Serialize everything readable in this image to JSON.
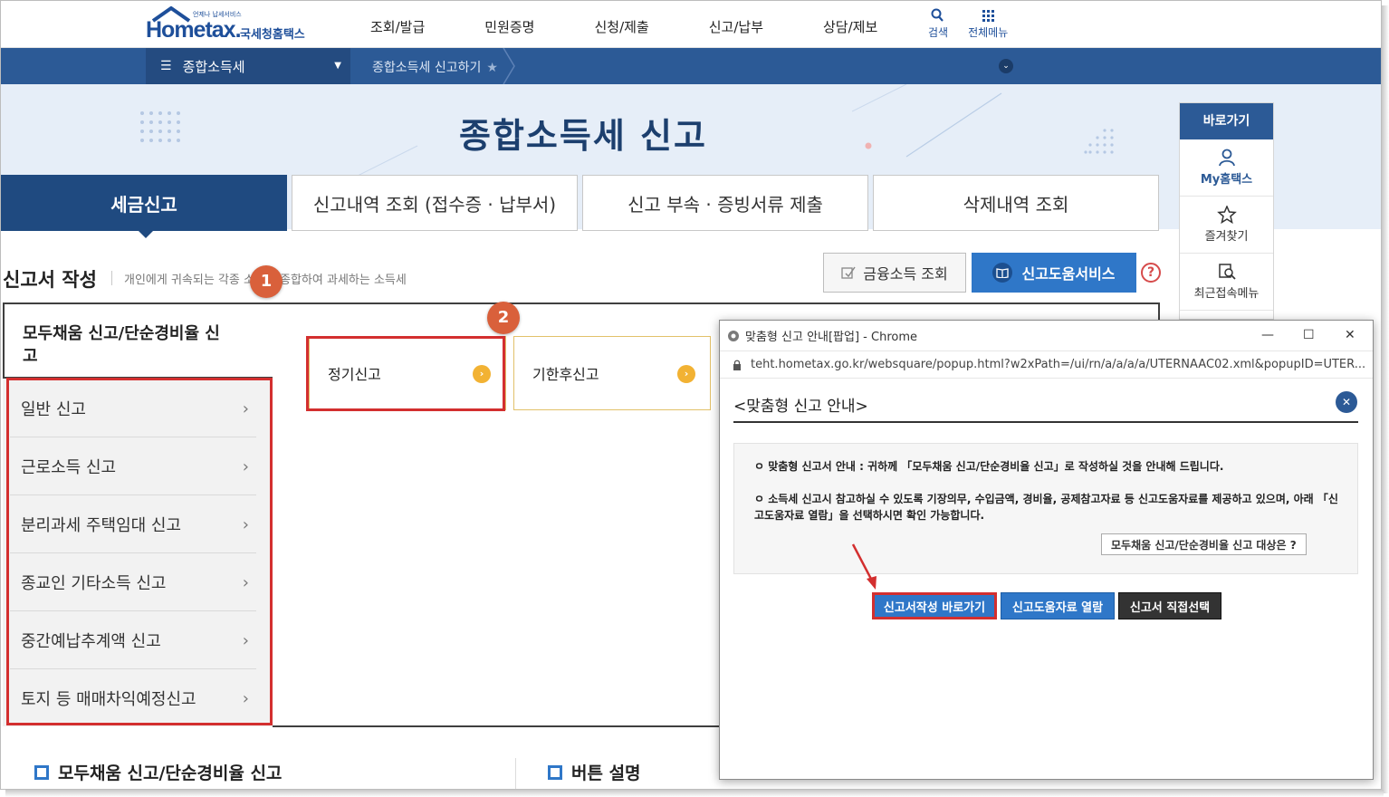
{
  "header": {
    "logo_brand": "Hometax.",
    "logo_small": "언제나 납세서비스",
    "logo_name": "국세청홈택스",
    "gnb": [
      "조회/발급",
      "민원증명",
      "신청/제출",
      "신고/납부",
      "상담/제보"
    ],
    "search_label": "검색",
    "all_menu_label": "전체메뉴"
  },
  "navbar": {
    "menu_label": "종합소득세",
    "breadcrumb": "종합소득세 신고하기"
  },
  "page": {
    "title": "종합소득세 신고"
  },
  "tabs": [
    "세금신고",
    "신고내역 조회 (접수증 · 납부서)",
    "신고 부속 · 증빙서류 제출",
    "삭제내역 조회"
  ],
  "quick": {
    "head": "바로가기",
    "items": [
      "My홈택스",
      "즐겨찾기",
      "최근접속메뉴"
    ]
  },
  "section": {
    "title": "신고서 작성",
    "desc": "개인에게 귀속되는 각종 소득을 종합하여 과세하는 소득세",
    "btn_fin": "금융소득 조회",
    "btn_help": "신고도움서비스",
    "help_q": "?"
  },
  "lnb": {
    "active": "모두채움 신고/단순경비율 신고",
    "items": [
      "일반 신고",
      "근로소득 신고",
      "분리과세 주택임대 신고",
      "종교인 기타소득 신고",
      "중간예납추계액 신고",
      "토지 등 매매차익예정신고"
    ]
  },
  "cards": [
    "정기신고",
    "기한후신고"
  ],
  "badges": [
    "1",
    "2"
  ],
  "bottom": {
    "left": "모두채움 신고/단순경비율 신고",
    "right": "버튼 설명"
  },
  "popup": {
    "window_title": "맞춤형 신고 안내[팝업] - Chrome",
    "url": "teht.hometax.go.kr/websquare/popup.html?w2xPath=/ui/rn/a/a/a/a/UTERNAAC02.xml&popupID=UTER...",
    "heading": "<맞춤형 신고 안내>",
    "line1": "ㅇ 맞춤형 신고서 안내 : 귀하께 「모두채움 신고/단순경비율 신고」로 작성하실 것을 안내해 드립니다.",
    "line2": "ㅇ 소득세 신고시 참고하실 수 있도록 기장의무, 수입금액, 경비율, 공제참고자료 등 신고도움자료를 제공하고 있으며, 아래 「신고도움자료 열람」을 선택하시면 확인 가능합니다.",
    "target_btn": "모두채움 신고/단순경비율 신고 대상은 ?",
    "btn_go": "신고서작성 바로가기",
    "btn_view": "신고도움자료 열람",
    "btn_direct": "신고서 직접선택"
  },
  "colors": {
    "navy": "#1f4a80",
    "nav_blue": "#2c5a96",
    "accent_blue": "#2f77c8",
    "highlight_red": "#d32f2f",
    "badge_orange": "#d9603b",
    "card_border": "#e2c16a",
    "card_go": "#f2b233"
  }
}
